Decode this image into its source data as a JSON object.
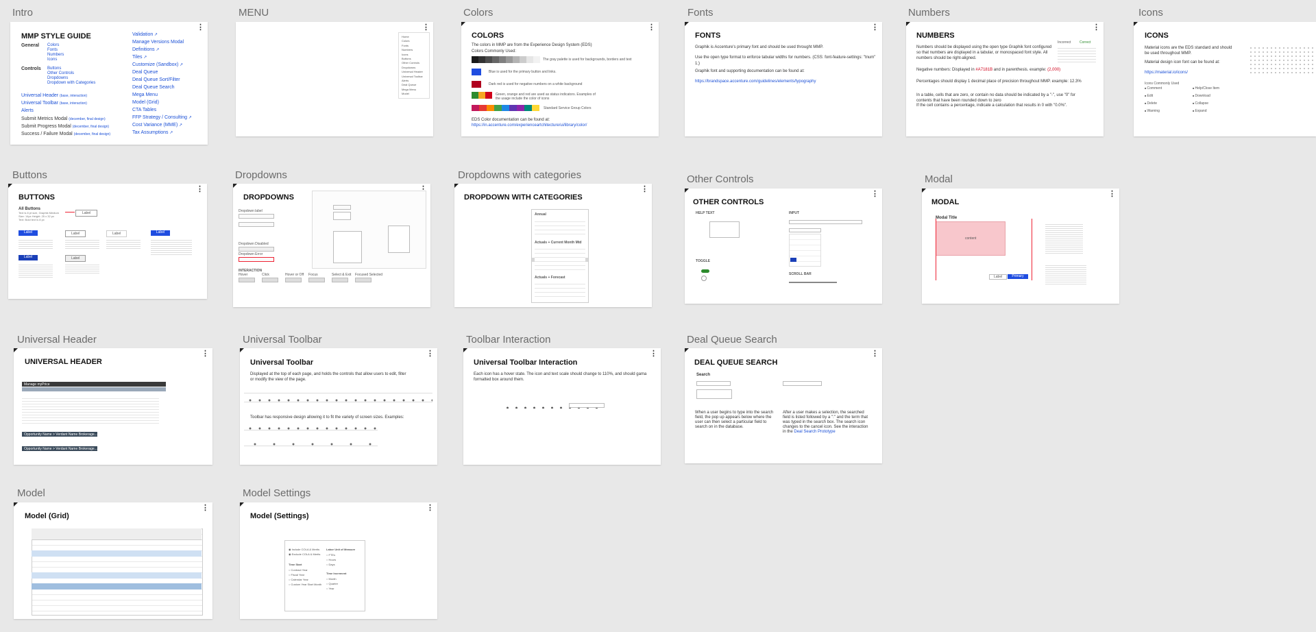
{
  "sections": {
    "intro": "Intro",
    "menu": "MENU",
    "colors": "Colors",
    "fonts": "Fonts",
    "numbers": "Numbers",
    "icons": "Icons",
    "buttons": "Buttons",
    "dropdowns": "Dropdowns",
    "dropdowns_cat": "Dropdowns with categories",
    "other_controls": "Other Controls",
    "modal": "Modal",
    "universal_header": "Universal Header",
    "universal_toolbar": "Universal Toolbar",
    "toolbar_interaction": "Toolbar Interaction",
    "deal_queue_search": "Deal Queue Search",
    "model": "Model",
    "model_settings": "Model Settings"
  },
  "intro": {
    "title": "MMP STYLE GUIDE",
    "general_label": "General",
    "general_items": [
      "Colors",
      "Fonts",
      "Numbers",
      "Icons"
    ],
    "controls_label": "Controls",
    "controls_items": [
      "Buttons",
      "Other Controls",
      "Dropdowns",
      "Dropdown with Categories"
    ],
    "universal_header": "Universal Header",
    "universal_toolbar": "Universal Toolbar",
    "base_interaction": "(base, interaction)",
    "alerts": "Alerts",
    "submit_metrics": "Submit Metrics Modal",
    "submit_progress": "Submit Progress Modal",
    "success_failure": "Success / Failure Modal",
    "december_final": "(december, final design)",
    "right_items": [
      "Validation",
      "Manage Versions Modal",
      "Definitions",
      "Tiles",
      "Customize (Sandbox)",
      "Deal Queue",
      "Deal Queue Sort/Filter",
      "Deal Queue Search",
      "Mega Menu",
      "Model (Grid)",
      "CTA Tables",
      "FFP Strategy / Consulting",
      "Cost Variance (MME)",
      "Tax Assumptions"
    ],
    "external_flags": [
      true,
      false,
      true,
      true,
      true,
      false,
      false,
      false,
      false,
      false,
      false,
      true,
      true,
      true
    ]
  },
  "menu": {
    "items": [
      "Home",
      "Colors",
      "Fonts",
      "Numbers",
      "Icons",
      "Buttons",
      "Other Controls",
      "Dropdowns",
      "Universal Header",
      "Universal Toolbar",
      "Alerts",
      "Deal Queue",
      "Mega Menu",
      "Model"
    ]
  },
  "colors": {
    "title": "COLORS",
    "intro": "The colors in MMP are from the Experience Design System (EDS)",
    "commonly_used": "Colors Commonly Used:",
    "gray_note": "The gray palette is used for backgrounds, borders and text",
    "blue_note": "Blue is used for the primary button and links.",
    "red_note": "Dark red is used for negative numbers on a white background",
    "status_note": "Green, orange and red are used as status indicators. Examples of the usage include the color of icons",
    "service_note": "Standard Service Group Colors",
    "eds_doc": "EDS Color documentation can be found at:",
    "eds_link": "https://in.accenture.com/experienceartchitecture/ui/library/color/",
    "grays": [
      "#1a1a1a",
      "#333333",
      "#4d4d4d",
      "#666666",
      "#808080",
      "#999999",
      "#b3b3b3",
      "#cccccc",
      "#e6e6e6",
      "#f2f2f2"
    ],
    "blue": "#1f4de0",
    "red": "#b0001e",
    "status": [
      "#2e8b2e",
      "#f5a623",
      "#d0021b"
    ],
    "service": [
      "#c2185b",
      "#e53935",
      "#fb8c00",
      "#43a047",
      "#1e88e5",
      "#5e35b1",
      "#8e24aa",
      "#00897b",
      "#fdd835"
    ]
  },
  "fonts": {
    "title": "FONTS",
    "line1": "Graphik is Accenture's primary font and should be used throught MMP.",
    "line2": "Use the open type format to enforce tabular widths for numbers. (CSS: font-feature-settings: \"tnum\" 1;)",
    "line3": "Graphik font and supporting documentation can be found at:",
    "link": "https://brandspace.accenture.com/guidelines/elements/typography"
  },
  "numbers": {
    "title": "NUMBERS",
    "p1": "Numbers should be displayed using the open type Graphik font configured so that numbers are displayed in a tabular, or monospaced font style. All numbers should be right-aligned.",
    "p2_prefix": "Negative numbers: Displayed in",
    "p2_color": "#A7181B",
    "p2_suffix": "and in parenthesis.  example:",
    "p2_example": "(2,000)",
    "p3": "Percentages should display 1 decimal place of precision throughout MMP.  example: 12.3%",
    "p4": "In a table, cells that are zero, or contain no data should be indicated by a \"-\", use \"0\" for contents that have been rounded down to zero",
    "p5": "If the cell contains a percentage, indicate a calculation that results in 0 with \"0.0%\".",
    "col1": "Incorrect",
    "col2": "Correct"
  },
  "icons": {
    "title": "ICONS",
    "p1": "Material icons are the EDS standard and should be used throughout MMP.",
    "p2": "Material design icon font can be found  at:",
    "link": "https://material.io/icons/",
    "commonly": "Icons Commonly Used",
    "list": [
      "Comment",
      "Edit",
      "Delete",
      "Warning",
      "Help/Close Item",
      "Download",
      "Collapse",
      "Expand"
    ]
  },
  "buttons": {
    "title": "BUTTONS",
    "all": "All Buttons",
    "label": "Label"
  },
  "dropdowns": {
    "title": "DROPDOWNS",
    "dropdown_label": "Dropdown label",
    "dropdown_disabled": "Dropdown Disabled",
    "dropdown_error": "Dropdown Error",
    "interaction": "INTERACTION",
    "states": [
      "Hover",
      "Click",
      "Hover or Off",
      "Focus",
      "Select & Exit",
      "Focused Selected"
    ]
  },
  "dropdowns_cat": {
    "title": "DROPDOWN WITH CATEGORIES",
    "cats": [
      "Annual",
      "Actuals + Current Month Mtd",
      "Actuals + Forecast"
    ]
  },
  "other_controls": {
    "title": "OTHER CONTROLS",
    "help_text": "HELP TEXT",
    "input": "INPUT",
    "toggle": "TOGGLE",
    "scroll": "SCROLL BAR"
  },
  "modal": {
    "title": "MODAL",
    "modal_title": "Modal Title",
    "content": "content",
    "label": "Label",
    "primary": "Primary"
  },
  "universal_header": {
    "title": "UNIVERSAL HEADER",
    "app_name": "Manage myPrice",
    "opportunity": "Opportunity Name > Verdant Name Brokerage..."
  },
  "universal_toolbar": {
    "title": "Universal Toolbar",
    "p1": "Displayed at the top of each page, and holds the controls that allow users to edit, filter or modify the view of the page.",
    "p2": "Toolbar has responsive design allowing it to fit the variety of screen sizes.  Examples:"
  },
  "toolbar_interaction": {
    "title": "Universal Toolbar Interaction",
    "p1": "Each icon has a hover state. The icon and text scale should change to 110%, and should gama formatted box around them."
  },
  "deal_queue_search": {
    "title": "DEAL QUEUE SEARCH",
    "search": "Search",
    "p1": "When a user begins to type into the search field, the pop up appears below where the user can then select a particular field to search on in the database.",
    "p2": "After a user makes a selection, the searched field is listed followed by a \":\" and the term that was typed in the search box. The search icon changes to the cancel icon. See the interaction in the",
    "p2_link": "Deal Search Prototype"
  },
  "model": {
    "title": "Model (Grid)"
  },
  "model_settings": {
    "title": "Model (Settings)",
    "opts": [
      "Include COLA & Merits",
      "Exclude COLA & Merits"
    ],
    "time_start": "Time Start",
    "time_opts": [
      "Contract Year",
      "Fiscal Year",
      "Calendar Year",
      "Custom Year Start Month"
    ],
    "labor_unit": "Labor Unit of Measure",
    "labor_opts": [
      "FTEs",
      "Hours",
      "Days"
    ],
    "time_inc": "Time Increment",
    "inc_opts": [
      "Month",
      "Quarter",
      "Year"
    ]
  }
}
